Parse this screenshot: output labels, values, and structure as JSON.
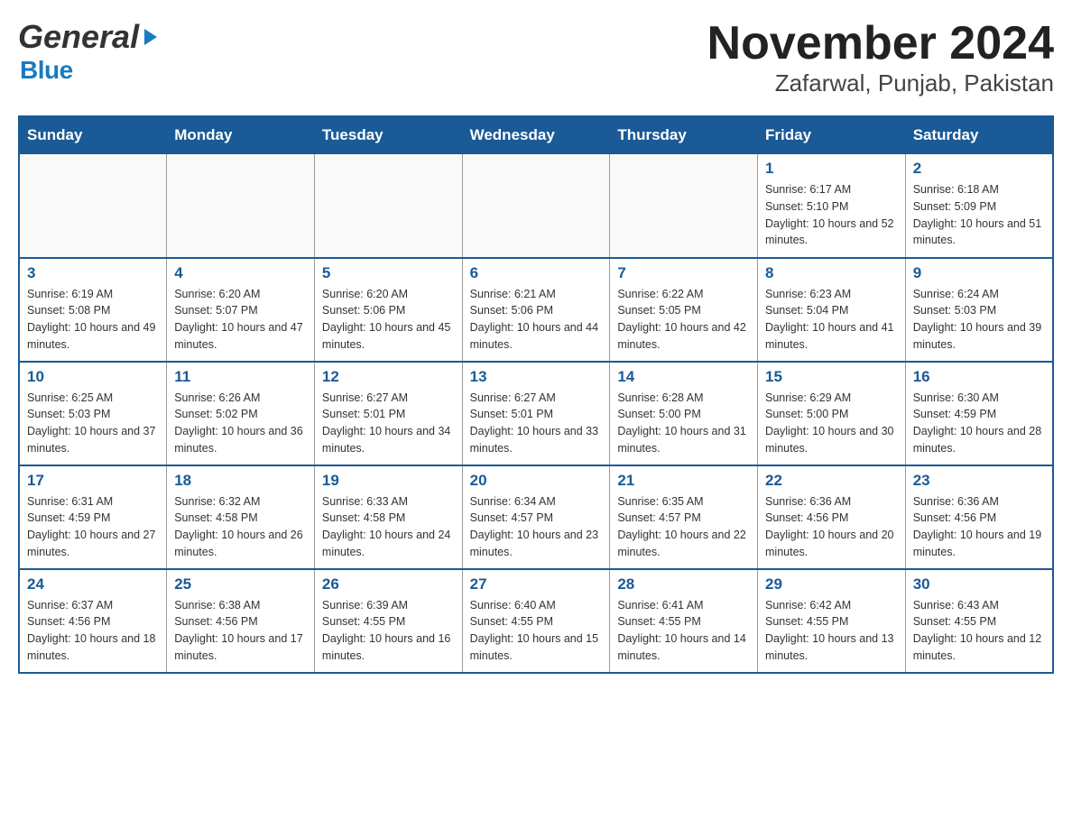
{
  "header": {
    "logo_general": "General",
    "logo_blue": "Blue",
    "title": "November 2024",
    "subtitle": "Zafarwal, Punjab, Pakistan"
  },
  "days_of_week": [
    "Sunday",
    "Monday",
    "Tuesday",
    "Wednesday",
    "Thursday",
    "Friday",
    "Saturday"
  ],
  "weeks": [
    [
      {
        "day": "",
        "info": ""
      },
      {
        "day": "",
        "info": ""
      },
      {
        "day": "",
        "info": ""
      },
      {
        "day": "",
        "info": ""
      },
      {
        "day": "",
        "info": ""
      },
      {
        "day": "1",
        "info": "Sunrise: 6:17 AM\nSunset: 5:10 PM\nDaylight: 10 hours and 52 minutes."
      },
      {
        "day": "2",
        "info": "Sunrise: 6:18 AM\nSunset: 5:09 PM\nDaylight: 10 hours and 51 minutes."
      }
    ],
    [
      {
        "day": "3",
        "info": "Sunrise: 6:19 AM\nSunset: 5:08 PM\nDaylight: 10 hours and 49 minutes."
      },
      {
        "day": "4",
        "info": "Sunrise: 6:20 AM\nSunset: 5:07 PM\nDaylight: 10 hours and 47 minutes."
      },
      {
        "day": "5",
        "info": "Sunrise: 6:20 AM\nSunset: 5:06 PM\nDaylight: 10 hours and 45 minutes."
      },
      {
        "day": "6",
        "info": "Sunrise: 6:21 AM\nSunset: 5:06 PM\nDaylight: 10 hours and 44 minutes."
      },
      {
        "day": "7",
        "info": "Sunrise: 6:22 AM\nSunset: 5:05 PM\nDaylight: 10 hours and 42 minutes."
      },
      {
        "day": "8",
        "info": "Sunrise: 6:23 AM\nSunset: 5:04 PM\nDaylight: 10 hours and 41 minutes."
      },
      {
        "day": "9",
        "info": "Sunrise: 6:24 AM\nSunset: 5:03 PM\nDaylight: 10 hours and 39 minutes."
      }
    ],
    [
      {
        "day": "10",
        "info": "Sunrise: 6:25 AM\nSunset: 5:03 PM\nDaylight: 10 hours and 37 minutes."
      },
      {
        "day": "11",
        "info": "Sunrise: 6:26 AM\nSunset: 5:02 PM\nDaylight: 10 hours and 36 minutes."
      },
      {
        "day": "12",
        "info": "Sunrise: 6:27 AM\nSunset: 5:01 PM\nDaylight: 10 hours and 34 minutes."
      },
      {
        "day": "13",
        "info": "Sunrise: 6:27 AM\nSunset: 5:01 PM\nDaylight: 10 hours and 33 minutes."
      },
      {
        "day": "14",
        "info": "Sunrise: 6:28 AM\nSunset: 5:00 PM\nDaylight: 10 hours and 31 minutes."
      },
      {
        "day": "15",
        "info": "Sunrise: 6:29 AM\nSunset: 5:00 PM\nDaylight: 10 hours and 30 minutes."
      },
      {
        "day": "16",
        "info": "Sunrise: 6:30 AM\nSunset: 4:59 PM\nDaylight: 10 hours and 28 minutes."
      }
    ],
    [
      {
        "day": "17",
        "info": "Sunrise: 6:31 AM\nSunset: 4:59 PM\nDaylight: 10 hours and 27 minutes."
      },
      {
        "day": "18",
        "info": "Sunrise: 6:32 AM\nSunset: 4:58 PM\nDaylight: 10 hours and 26 minutes."
      },
      {
        "day": "19",
        "info": "Sunrise: 6:33 AM\nSunset: 4:58 PM\nDaylight: 10 hours and 24 minutes."
      },
      {
        "day": "20",
        "info": "Sunrise: 6:34 AM\nSunset: 4:57 PM\nDaylight: 10 hours and 23 minutes."
      },
      {
        "day": "21",
        "info": "Sunrise: 6:35 AM\nSunset: 4:57 PM\nDaylight: 10 hours and 22 minutes."
      },
      {
        "day": "22",
        "info": "Sunrise: 6:36 AM\nSunset: 4:56 PM\nDaylight: 10 hours and 20 minutes."
      },
      {
        "day": "23",
        "info": "Sunrise: 6:36 AM\nSunset: 4:56 PM\nDaylight: 10 hours and 19 minutes."
      }
    ],
    [
      {
        "day": "24",
        "info": "Sunrise: 6:37 AM\nSunset: 4:56 PM\nDaylight: 10 hours and 18 minutes."
      },
      {
        "day": "25",
        "info": "Sunrise: 6:38 AM\nSunset: 4:56 PM\nDaylight: 10 hours and 17 minutes."
      },
      {
        "day": "26",
        "info": "Sunrise: 6:39 AM\nSunset: 4:55 PM\nDaylight: 10 hours and 16 minutes."
      },
      {
        "day": "27",
        "info": "Sunrise: 6:40 AM\nSunset: 4:55 PM\nDaylight: 10 hours and 15 minutes."
      },
      {
        "day": "28",
        "info": "Sunrise: 6:41 AM\nSunset: 4:55 PM\nDaylight: 10 hours and 14 minutes."
      },
      {
        "day": "29",
        "info": "Sunrise: 6:42 AM\nSunset: 4:55 PM\nDaylight: 10 hours and 13 minutes."
      },
      {
        "day": "30",
        "info": "Sunrise: 6:43 AM\nSunset: 4:55 PM\nDaylight: 10 hours and 12 minutes."
      }
    ]
  ]
}
